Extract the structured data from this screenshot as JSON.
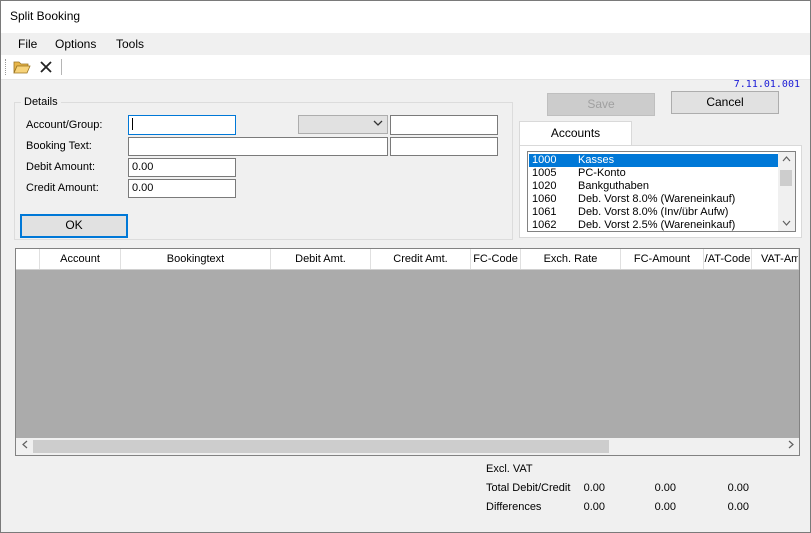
{
  "window": {
    "title": "Split Booking"
  },
  "menu": [
    "File",
    "Options",
    "Tools"
  ],
  "toolbar": {
    "open_icon": "folder-open-icon",
    "close_icon": "x-icon"
  },
  "version": "7.11.01.001",
  "details": {
    "legend": "Details",
    "account_label": "Account/Group:",
    "account_value": "",
    "booking_text_label": "Booking Text:",
    "booking_text_value": "",
    "debit_label": "Debit Amount:",
    "debit_value": "0.00",
    "credit_label": "Credit Amount:",
    "credit_value": "0.00",
    "ok_label": "OK"
  },
  "buttons": {
    "save": "Save",
    "cancel": "Cancel"
  },
  "accounts": {
    "tab_label": "Accounts",
    "items": [
      {
        "code": "1000",
        "name": "Kasses",
        "selected": true
      },
      {
        "code": "1005",
        "name": "PC-Konto"
      },
      {
        "code": "1020",
        "name": "Bankguthaben"
      },
      {
        "code": "1060",
        "name": "Deb. Vorst 8.0% (Wareneinkauf)"
      },
      {
        "code": "1061",
        "name": "Deb. Vorst 8.0% (Inv/übr Aufw)"
      },
      {
        "code": "1062",
        "name": "Deb. Vorst 2.5% (Wareneinkauf)"
      }
    ]
  },
  "grid": {
    "columns": [
      "",
      "Account",
      "Bookingtext",
      "Debit Amt.",
      "Credit Amt.",
      "FC-Code",
      "Exch. Rate",
      "FC-Amount",
      "/AT-Code",
      "VAT-Am"
    ]
  },
  "summary": {
    "excl_vat_label": "Excl. VAT",
    "total_label": "Total Debit/Credit",
    "total_values": [
      "0.00",
      "0.00",
      "0.00"
    ],
    "diff_label": "Differences",
    "diff_values": [
      "0.00",
      "0.00",
      "0.00"
    ]
  }
}
